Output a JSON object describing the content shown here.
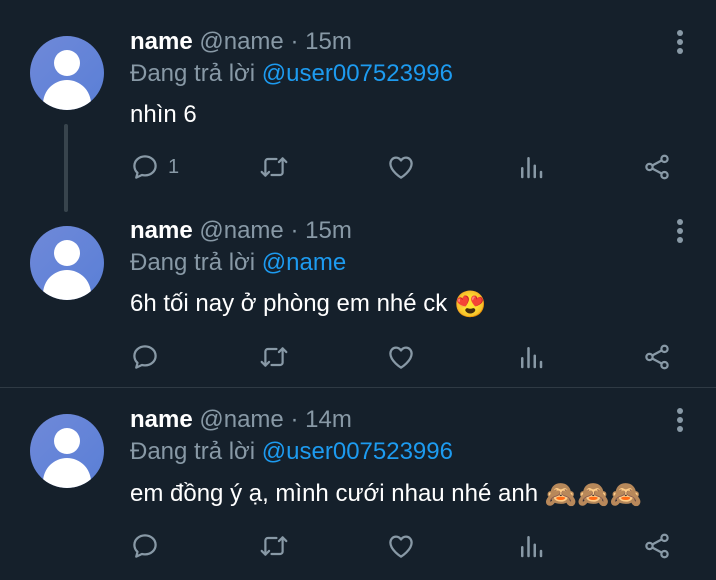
{
  "tweets": [
    {
      "name": "name",
      "handle": "@name",
      "time": "15m",
      "reply_prefix": "Đang trả lời ",
      "reply_to": "@user007523996",
      "text": "nhìn 6",
      "emoji": "",
      "reply_count": "1"
    },
    {
      "name": "name",
      "handle": "@name",
      "time": "15m",
      "reply_prefix": "Đang trả lời ",
      "reply_to": "@name",
      "text": "6h tối nay ở phòng em nhé ck ",
      "emoji": "😍",
      "reply_count": ""
    },
    {
      "name": "name",
      "handle": "@name",
      "time": "14m",
      "reply_prefix": "Đang trả lời ",
      "reply_to": "@user007523996",
      "text": "em đồng ý ạ, mình cưới nhau nhé anh ",
      "emoji": "🙈🙈🙈",
      "reply_count": ""
    }
  ],
  "icons": {
    "reply": "reply-icon",
    "retweet": "retweet-icon",
    "like": "heart-icon",
    "analytics": "analytics-icon",
    "share": "share-icon",
    "more": "more-vertical-icon"
  },
  "colors": {
    "background": "#15202b",
    "mention": "#1d9bf0",
    "muted": "#8899a6"
  }
}
